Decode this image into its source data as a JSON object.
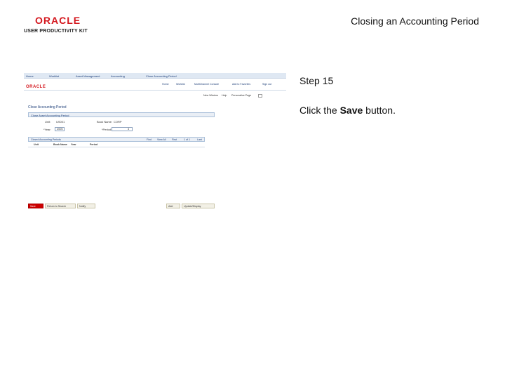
{
  "header": {
    "logo_top": "ORACLE",
    "logo_bottom": "USER PRODUCTIVITY KIT",
    "title": "Closing an Accounting Period"
  },
  "step": {
    "label": "Step 15",
    "instruction_prefix": "Click the ",
    "instruction_bold": "Save",
    "instruction_suffix": " button."
  },
  "screenshot": {
    "topnav": [
      "Home",
      "Worklist",
      "Asset Management",
      "Accounting",
      "Close Accounting Period"
    ],
    "oracle": "ORACLE",
    "menus": [
      "Home",
      "Worklist",
      "MultiChannel Console",
      "Add to Favorites",
      "Sign out"
    ],
    "toolbar": [
      "New Window",
      "Help",
      "Personalize Page"
    ],
    "page_heading": "Close Accounting Period",
    "section_title": "Close Asset Accounting Period",
    "fields": {
      "unit_label": "Unit:",
      "unit_value": "US001",
      "book_label": "Book Name:",
      "book_value": "CORP",
      "year_label": "*Year:",
      "year_value": "2005",
      "period_label": "*Period:",
      "period_value": "3"
    },
    "grid": {
      "title": "Closed Accounting Periods",
      "nav": [
        "Find",
        "View All",
        "First",
        "1 of 1",
        "Last"
      ],
      "columns": [
        "Unit",
        "Book Name",
        "Year",
        "Period"
      ]
    },
    "bottom_buttons": {
      "save": "Save",
      "return": "Return to Search",
      "notify": "Notify",
      "add": "Add",
      "update": "Update/Display"
    }
  }
}
